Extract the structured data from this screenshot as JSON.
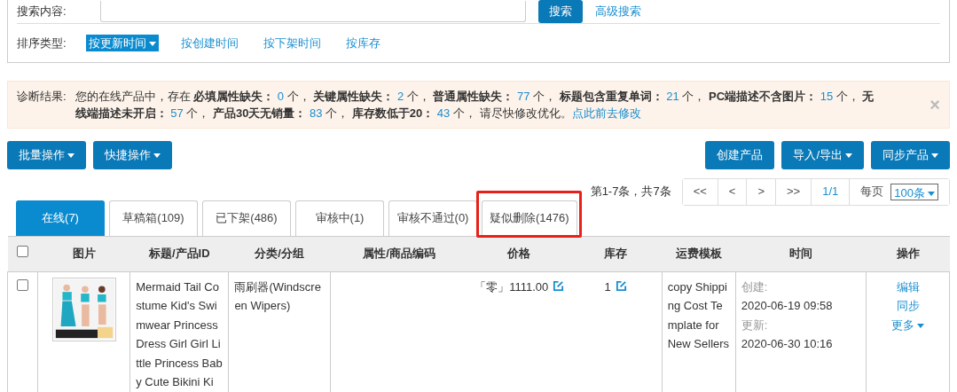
{
  "search": {
    "label": "搜索内容:",
    "button": "搜索",
    "advanced_link": "高级搜索"
  },
  "sort": {
    "label": "排序类型:",
    "options": [
      {
        "label": "按更新时间",
        "selected": true
      },
      {
        "label": "按创建时间",
        "selected": false
      },
      {
        "label": "按下架时间",
        "selected": false
      },
      {
        "label": "按库存",
        "selected": false
      }
    ]
  },
  "diagnosis": {
    "label": "诊断结果:",
    "intro": "您的在线产品中，存在",
    "items": [
      {
        "label": "必填属性缺失：",
        "count": "0",
        "unit": "个，"
      },
      {
        "label": "关键属性缺失：",
        "count": "2",
        "unit": "个，"
      },
      {
        "label": "普通属性缺失：",
        "count": "77",
        "unit": "个，"
      },
      {
        "label": "标题包含重复单词：",
        "count": "21",
        "unit": "个，"
      },
      {
        "label": "PC端描述不含图片：",
        "count": "15",
        "unit": "个，"
      },
      {
        "label": "无线端描述未开启：",
        "count": "57",
        "unit": "个，"
      },
      {
        "label": "产品30天无销量：",
        "count": "83",
        "unit": "个，"
      },
      {
        "label": "库存数低于20：",
        "count": "43",
        "unit": "个，"
      }
    ],
    "outro": "请尽快修改优化。",
    "link": "点此前去修改",
    "close": "×"
  },
  "toolbar_left": [
    {
      "label": "批量操作",
      "caret": true
    },
    {
      "label": "快捷操作",
      "caret": true
    }
  ],
  "toolbar_right": [
    {
      "label": "创建产品",
      "caret": false
    },
    {
      "label": "导入/导出",
      "caret": true
    },
    {
      "label": "同步产品",
      "caret": true
    }
  ],
  "pagination": {
    "summary": "第1-7条，共7条",
    "buttons": [
      "<<",
      "<",
      ">",
      ">>"
    ],
    "page": "1/1",
    "per_page_label": "每页",
    "per_page": "100条"
  },
  "tabs": [
    {
      "label": "在线(7)",
      "selected": true,
      "highlighted": false
    },
    {
      "label": "草稿箱(109)",
      "selected": false,
      "highlighted": false
    },
    {
      "label": "已下架(486)",
      "selected": false,
      "highlighted": false
    },
    {
      "label": "审核中(1)",
      "selected": false,
      "highlighted": false
    },
    {
      "label": "审核不通过(0)",
      "selected": false,
      "highlighted": false
    },
    {
      "label": "疑似删除(1476)",
      "selected": false,
      "highlighted": true
    }
  ],
  "table": {
    "select_all_checked": false,
    "columns": [
      "图片",
      "标题/产品ID",
      "分类/分组",
      "属性/商品编码",
      "价格",
      "库存",
      "运费模板",
      "时间",
      "操作"
    ],
    "rows": [
      {
        "checked": false,
        "image": {
          "kind": "picture"
        },
        "title": "Mermaid Tail Costume Kid's Swimwear Princess Dress Girl Girl Little Princess Baby Cute Bikini Ki",
        "category": "雨刷器(Windscreen Wipers)",
        "price": "「零」1111.00",
        "stock": "1",
        "shipping": "copy Shipping Cost Template for New Sellers",
        "created_label": "创建:",
        "created": "2020-06-19 09:58",
        "updated_label": "更新:",
        "updated": "2020-06-30 10:16",
        "actions": [
          "编辑",
          "同步",
          "更多"
        ]
      }
    ]
  }
}
